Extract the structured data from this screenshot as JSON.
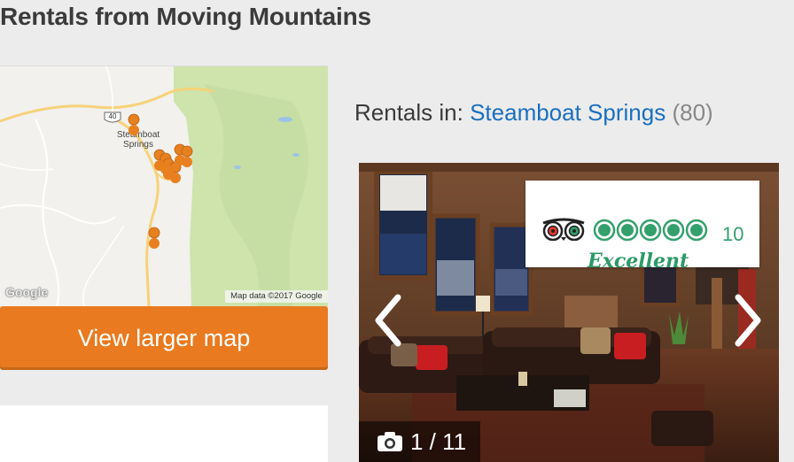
{
  "page": {
    "title": "Rentals from Moving Mountains"
  },
  "map": {
    "city_label_line1": "Steamboat",
    "city_label_line2": "Springs",
    "highway_label": "40",
    "google_logo": "Google",
    "credit": "Map data ©2017 Google",
    "view_larger_label": "View larger map",
    "pin_color": "#e8801f",
    "land_color": "#f2f1ed",
    "forest_color": "#cfe3ad"
  },
  "rentals": {
    "prefix": "Rentals in:",
    "location": "Steamboat Springs",
    "count": "(80)"
  },
  "listing": {
    "review_count": "10",
    "rating_label": "Excellent",
    "rating_bubbles": 5,
    "brand_color": "#34a06c",
    "photo_counter": "1 / 11",
    "icons": {
      "rating_logo": "tripadvisor-owl-icon",
      "prev": "chevron-left-icon",
      "next": "chevron-right-icon",
      "camera": "camera-icon"
    }
  }
}
